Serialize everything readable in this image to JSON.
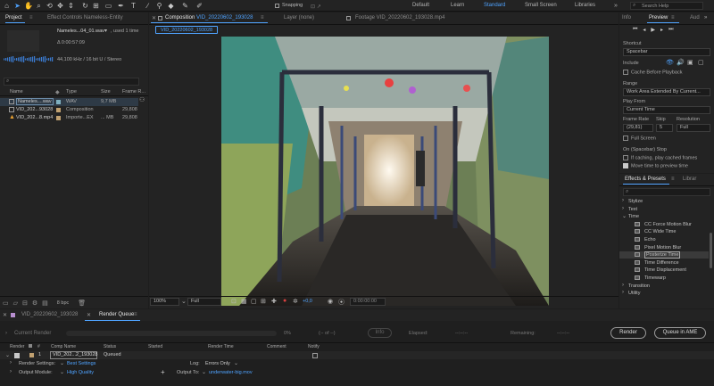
{
  "workspace": [
    "Default",
    "Learn",
    "Standard",
    "Small Screen",
    "Libraries"
  ],
  "search_help_placeholder": "Search Help",
  "snapping_label": "Snapping",
  "project_panel": {
    "tab": "Project",
    "effect_controls_tab": "Effect Controls Nameless-Entity",
    "selected_name": "Nameles...04_01.wav",
    "used_count": ", used 1 time",
    "duration": "Δ 0:00:57:09",
    "audio_info": "44,100 kHz / 16 bit U / Stereo",
    "search_placeholder": "",
    "columns": [
      "Name",
      "Type",
      "Size",
      "Frame R..."
    ],
    "items": [
      {
        "name": "Nameles....wav",
        "type": "WAV",
        "size": "9,7 MB",
        "fps": "",
        "color": "#7fb0c0",
        "icon": "audio-file-icon"
      },
      {
        "name": "VID_202...93028",
        "type": "Composition",
        "size": "",
        "fps": "29,808",
        "color": "#c0a070",
        "icon": "composition-icon"
      },
      {
        "name": "VID_202...8.mp4",
        "type": "Importe...EX",
        "size": "... MB",
        "fps": "29,808",
        "color": "#c0a070",
        "icon": "video-file-icon"
      }
    ],
    "bpc": "8 bpc"
  },
  "composition_panel": {
    "tab_prefix": "Composition",
    "tab_name": "VID_20220602_193028",
    "layer_tab": "Layer (none)",
    "footage_tab": "Footage VID_20220602_193028.mp4",
    "breadcrumb": "VID_20220602_193028",
    "zoom": "100%",
    "resolution": "Full",
    "exposure": "+0,0",
    "timecode": "0:00:00:00"
  },
  "preview_panel": {
    "info_tab": "Info",
    "preview_tab": "Preview",
    "audio_tab": "Aud",
    "shortcut_label": "Shortcut",
    "shortcut_value": "Spacebar",
    "include_label": "Include",
    "cache_before_playback": "Cache Before Playback",
    "range_label": "Range",
    "range_value": "Work Area Extended By Current...",
    "play_from_label": "Play From",
    "play_from_value": "Current Time",
    "frame_rate_label": "Frame Rate",
    "skip_label": "Skip",
    "resolution_label": "Resolution",
    "frame_rate_value": "(29,81)",
    "skip_value": "5",
    "resolution_value": "Full",
    "full_screen": "Full Screen",
    "on_stop_label": "On (Spacebar) Stop",
    "if_caching": "If caching, play cached frames",
    "move_time": "Move time to preview time"
  },
  "effects_panel": {
    "tab": "Effects & Presets",
    "libraries_tab": "Librar",
    "search_placeholder": "",
    "items": [
      {
        "label": "Stylize",
        "indent": 0,
        "arrow": "›"
      },
      {
        "label": "Text",
        "indent": 0,
        "arrow": "›"
      },
      {
        "label": "Time",
        "indent": 0,
        "arrow": "⌄"
      },
      {
        "label": "CC Force Motion Blur",
        "indent": 1,
        "arrow": ""
      },
      {
        "label": "CC Wide Time",
        "indent": 1,
        "arrow": ""
      },
      {
        "label": "Echo",
        "indent": 1,
        "arrow": ""
      },
      {
        "label": "Pixel Motion Blur",
        "indent": 1,
        "arrow": ""
      },
      {
        "label": "Posterize Time",
        "indent": 1,
        "arrow": "",
        "selected": true
      },
      {
        "label": "Time Difference",
        "indent": 1,
        "arrow": ""
      },
      {
        "label": "Time Displacement",
        "indent": 1,
        "arrow": ""
      },
      {
        "label": "Timewarp",
        "indent": 1,
        "arrow": ""
      },
      {
        "label": "Transition",
        "indent": 0,
        "arrow": "›"
      },
      {
        "label": "Utility",
        "indent": 0,
        "arrow": "›"
      }
    ]
  },
  "render_queue": {
    "timeline_tab": "VID_20220602_193028",
    "tab": "Render Queue",
    "current_render": "Current Render",
    "progress_pct": "0%",
    "progress_of": "(-- of --)",
    "info_btn": "Info",
    "elapsed_label": "Elapsed:",
    "elapsed_value": "--:--:--",
    "remaining_label": "Remaining:",
    "remaining_value": "--:--:--",
    "render_btn": "Render",
    "ame_btn": "Queue in AME",
    "columns": [
      "Render",
      "#",
      "Comp Name",
      "Status",
      "Started",
      "Render Time",
      "Comment",
      "Notify"
    ],
    "item": {
      "num": "1",
      "comp": "VID_202...2_193028",
      "status": "Queued"
    },
    "render_settings_label": "Render Settings:",
    "render_settings_value": "Best Settings",
    "log_label": "Log:",
    "log_value": "Errors Only",
    "output_module_label": "Output Module:",
    "output_module_value": "High Quality",
    "output_to_label": "Output To:",
    "output_to_value": "underwater-big.mov"
  },
  "colors": {
    "accent": "#4fa3ff",
    "panel": "#232323",
    "bg": "#1d1d1d"
  }
}
